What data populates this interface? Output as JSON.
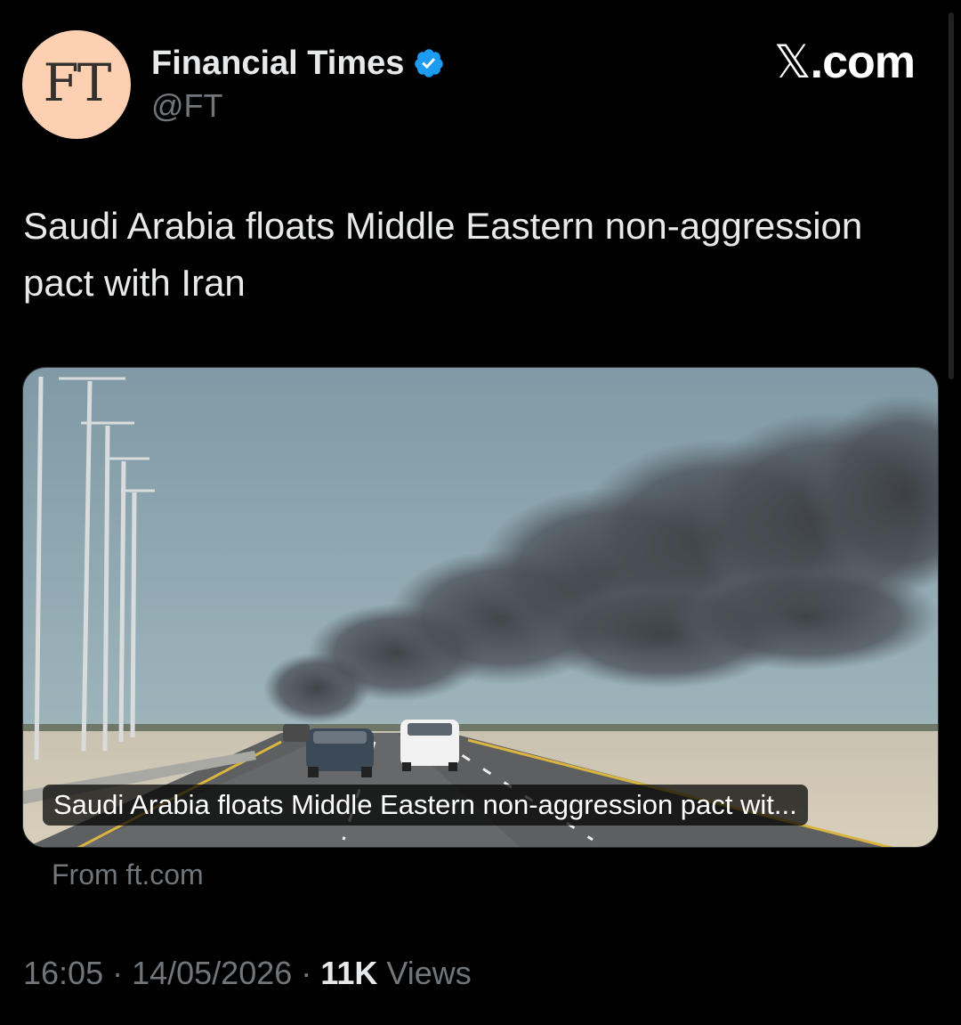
{
  "account": {
    "avatar_text": "FT",
    "display_name": "Financial Times",
    "handle": "@FT",
    "verified": true
  },
  "brand": {
    "mark": "𝕏",
    "label": ".com"
  },
  "tweet": {
    "text": "Saudi Arabia floats Middle Eastern non-aggression pact with Iran"
  },
  "card": {
    "caption": "Saudi Arabia floats Middle Eastern non-aggression pact wit...",
    "source": "From ft.com"
  },
  "meta": {
    "time": "16:05",
    "separator1": " · ",
    "date": "14/05/2026",
    "separator2": " · ",
    "views_count": "11K",
    "views_label": " Views"
  },
  "colors": {
    "background": "#000000",
    "text_primary": "#e7e9ea",
    "text_secondary": "#71767b",
    "verified_blue": "#1d9bf0",
    "ft_avatar": "#fcd0b1"
  },
  "icons": {
    "verified": "verified-badge-icon"
  }
}
